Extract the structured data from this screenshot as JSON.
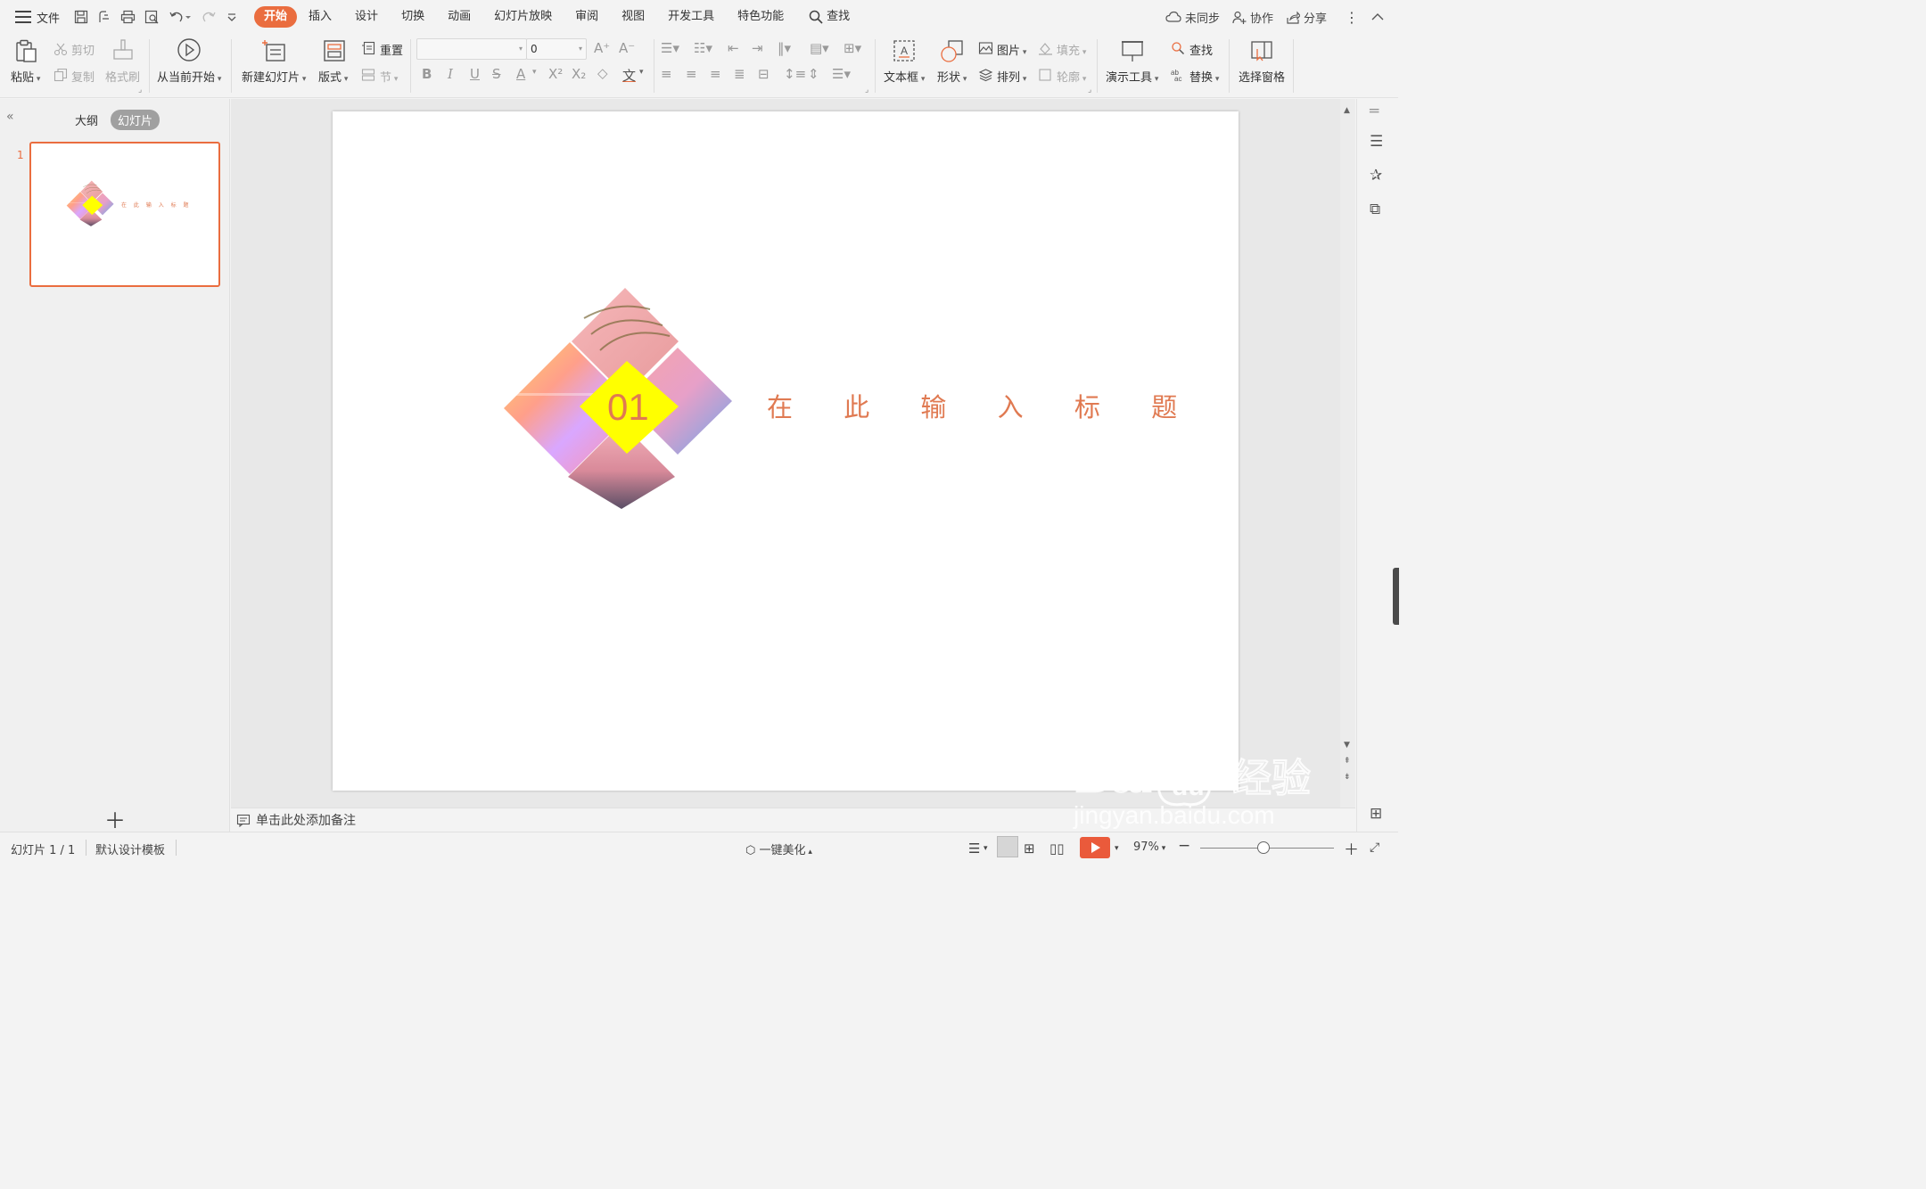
{
  "menubar": {
    "file_label": "文件",
    "tabs": [
      "开始",
      "插入",
      "设计",
      "切换",
      "动画",
      "幻灯片放映",
      "审阅",
      "视图",
      "开发工具",
      "特色功能"
    ],
    "search_label": "查找",
    "sync_label": "未同步",
    "collab_label": "协作",
    "share_label": "分享"
  },
  "ribbon": {
    "paste": "粘贴",
    "cut": "剪切",
    "copy": "复制",
    "format_painter": "格式刷",
    "from_current": "从当前开始",
    "new_slide": "新建幻灯片",
    "layout": "版式",
    "reset": "重置",
    "section": "节",
    "font_size": "0",
    "textbox": "文本框",
    "shape": "形状",
    "picture": "图片",
    "fill": "填充",
    "arrange": "排列",
    "outline": "轮廓",
    "present_tool": "演示工具",
    "find": "查找",
    "replace": "替换",
    "select_pane": "选择窗格"
  },
  "left_panel": {
    "outline_tab": "大纲",
    "slides_tab": "幻灯片",
    "slide_number": "1"
  },
  "slide": {
    "number_badge": "01",
    "title": "在 此 输 入 标 题",
    "thumb_title": "在 此 输 入 标 题",
    "accent_color": "#e07a52",
    "badge_color": "#ffff00"
  },
  "notes": {
    "placeholder": "单击此处添加备注"
  },
  "status": {
    "slide_counter": "幻灯片 1 / 1",
    "template": "默认设计模板",
    "beautify": "一键美化",
    "zoom": "97%"
  },
  "watermark": {
    "line1": "Bai du 经验",
    "line2": "jingyan.baidu.com"
  }
}
